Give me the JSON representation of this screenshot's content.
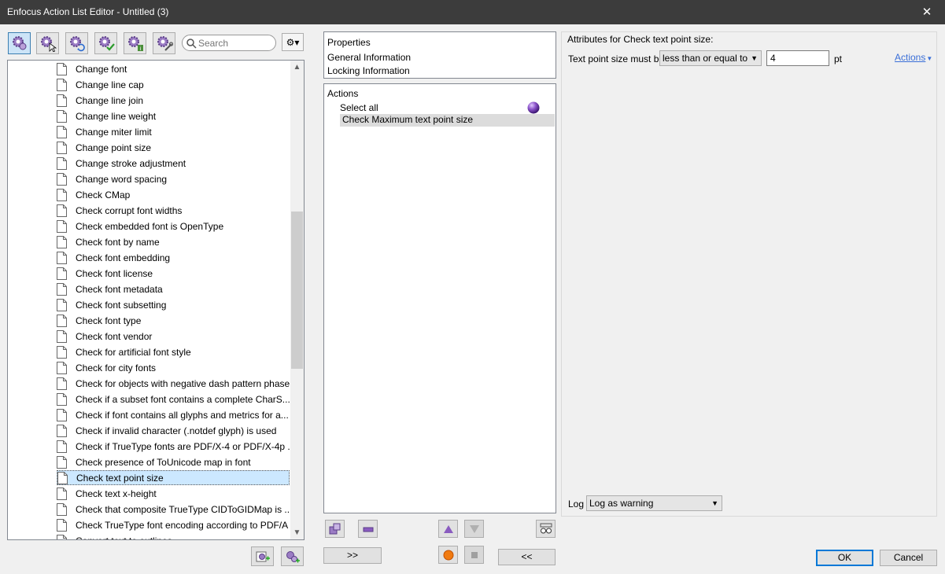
{
  "window": {
    "title": "Enfocus Action List Editor - Untitled (3)",
    "close_glyph": "✕"
  },
  "toolbar": {
    "buttons": [
      {
        "icon": "gear-cluster-icon"
      },
      {
        "icon": "gear-cursor-icon"
      },
      {
        "icon": "gear-refresh-icon"
      },
      {
        "icon": "gear-check-icon"
      },
      {
        "icon": "gear-info-icon"
      },
      {
        "icon": "gear-wrench-icon"
      }
    ],
    "search_placeholder": "Search",
    "settings_glyph": "⚙▾"
  },
  "action_library": {
    "items": [
      "Change font",
      "Change line cap",
      "Change line join",
      "Change line weight",
      "Change miter limit",
      "Change point size",
      "Change stroke adjustment",
      "Change word spacing",
      "Check CMap",
      "Check corrupt font widths",
      "Check embedded font is OpenType",
      "Check font by name",
      "Check font embedding",
      "Check font license",
      "Check font metadata",
      "Check font subsetting",
      "Check font type",
      "Check font vendor",
      "Check for artificial font style",
      "Check for city fonts",
      "Check for objects with negative dash pattern phase",
      "Check if a subset font contains a complete CharS...",
      "Check if font contains all glyphs and metrics for a...",
      "Check if invalid character (.notdef glyph) is used",
      "Check if TrueType fonts are PDF/X-4 or PDF/X-4p ...",
      "Check presence of ToUnicode map in font",
      "Check text point size",
      "Check text x-height",
      "Check that composite TrueType CIDToGIDMap is ...",
      "Check TrueType font encoding according to PDF/A",
      "Convert text to outlines"
    ],
    "selected_item": "Check text point size"
  },
  "properties": {
    "header": "Properties",
    "items": [
      "General Information",
      "Locking Information"
    ]
  },
  "actions": {
    "header": "Actions",
    "items": [
      "Select all",
      "Check Maximum text point size"
    ]
  },
  "buttons": {
    "add": ">>",
    "remove": "<<",
    "ok": "OK",
    "cancel": "Cancel"
  },
  "attributes": {
    "header": "Attributes for Check text point size:",
    "label": "Text point size must be",
    "comparison": "less than or equal to",
    "value": "4",
    "unit": "pt",
    "actions_link": "Actions",
    "log_label": "Log",
    "log_value": "Log as warning"
  },
  "colors": {
    "titlebar": "#3c3c3c",
    "accent_purple": "#7b4fa8",
    "selection": "#cce8ff",
    "link": "#3a6fd8"
  }
}
